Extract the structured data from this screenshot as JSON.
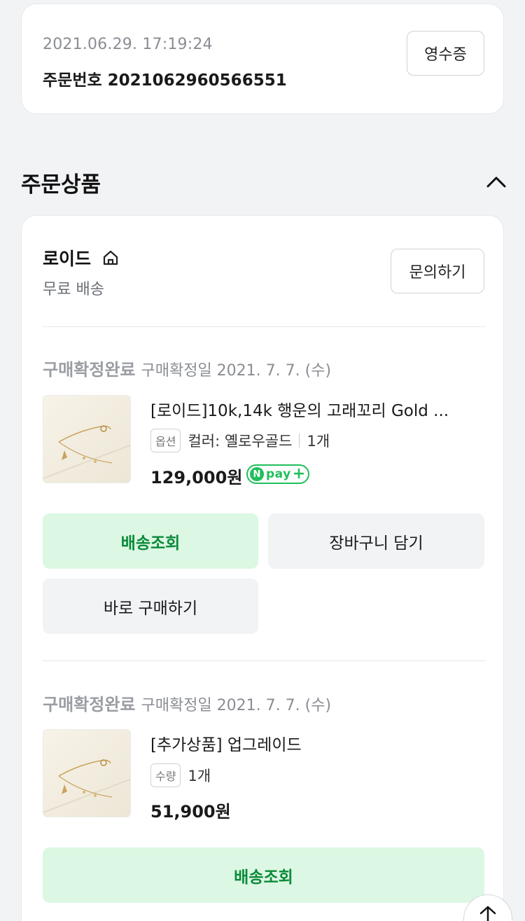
{
  "order": {
    "datetime": "2021.06.29. 17:19:24",
    "number_label": "주문번호 2021062960566551",
    "receipt_button": "영수증"
  },
  "section": {
    "title": "주문상품",
    "collapse_icon": "chevron-up-icon"
  },
  "seller": {
    "name": "로이드",
    "store_icon": "home-icon",
    "shipping": "무료 배송",
    "inquiry_button": "문의하기"
  },
  "items": [
    {
      "status": "구매확정완료",
      "confirm_date": "구매확정일 2021. 7. 7. (수)",
      "name": "[로이드]10k,14k 행운의 고래꼬리 Gold ...",
      "option_tag": "옵션",
      "option_text": "컬러: 옐로우골드",
      "quantity": "1개",
      "price": "129,000원",
      "npay_badge": {
        "n": "N",
        "text": "pay"
      },
      "buttons": {
        "track": "배송조회",
        "cart": "장바구니 담기",
        "buy_now": "바로 구매하기"
      }
    },
    {
      "status": "구매확정완료",
      "confirm_date": "구매확정일 2021. 7. 7. (수)",
      "name": "[추가상품] 업그레이드",
      "option_tag": "수량",
      "quantity": "1개",
      "price": "51,900원",
      "buttons": {
        "track": "배송조회"
      }
    }
  ],
  "scroll_top_icon": "arrow-up-icon",
  "colors": {
    "accent_green": "#20c05c",
    "green_button_bg": "#dcf7e3",
    "green_button_text": "#0a8a3a",
    "page_bg": "#f2f3f5"
  }
}
